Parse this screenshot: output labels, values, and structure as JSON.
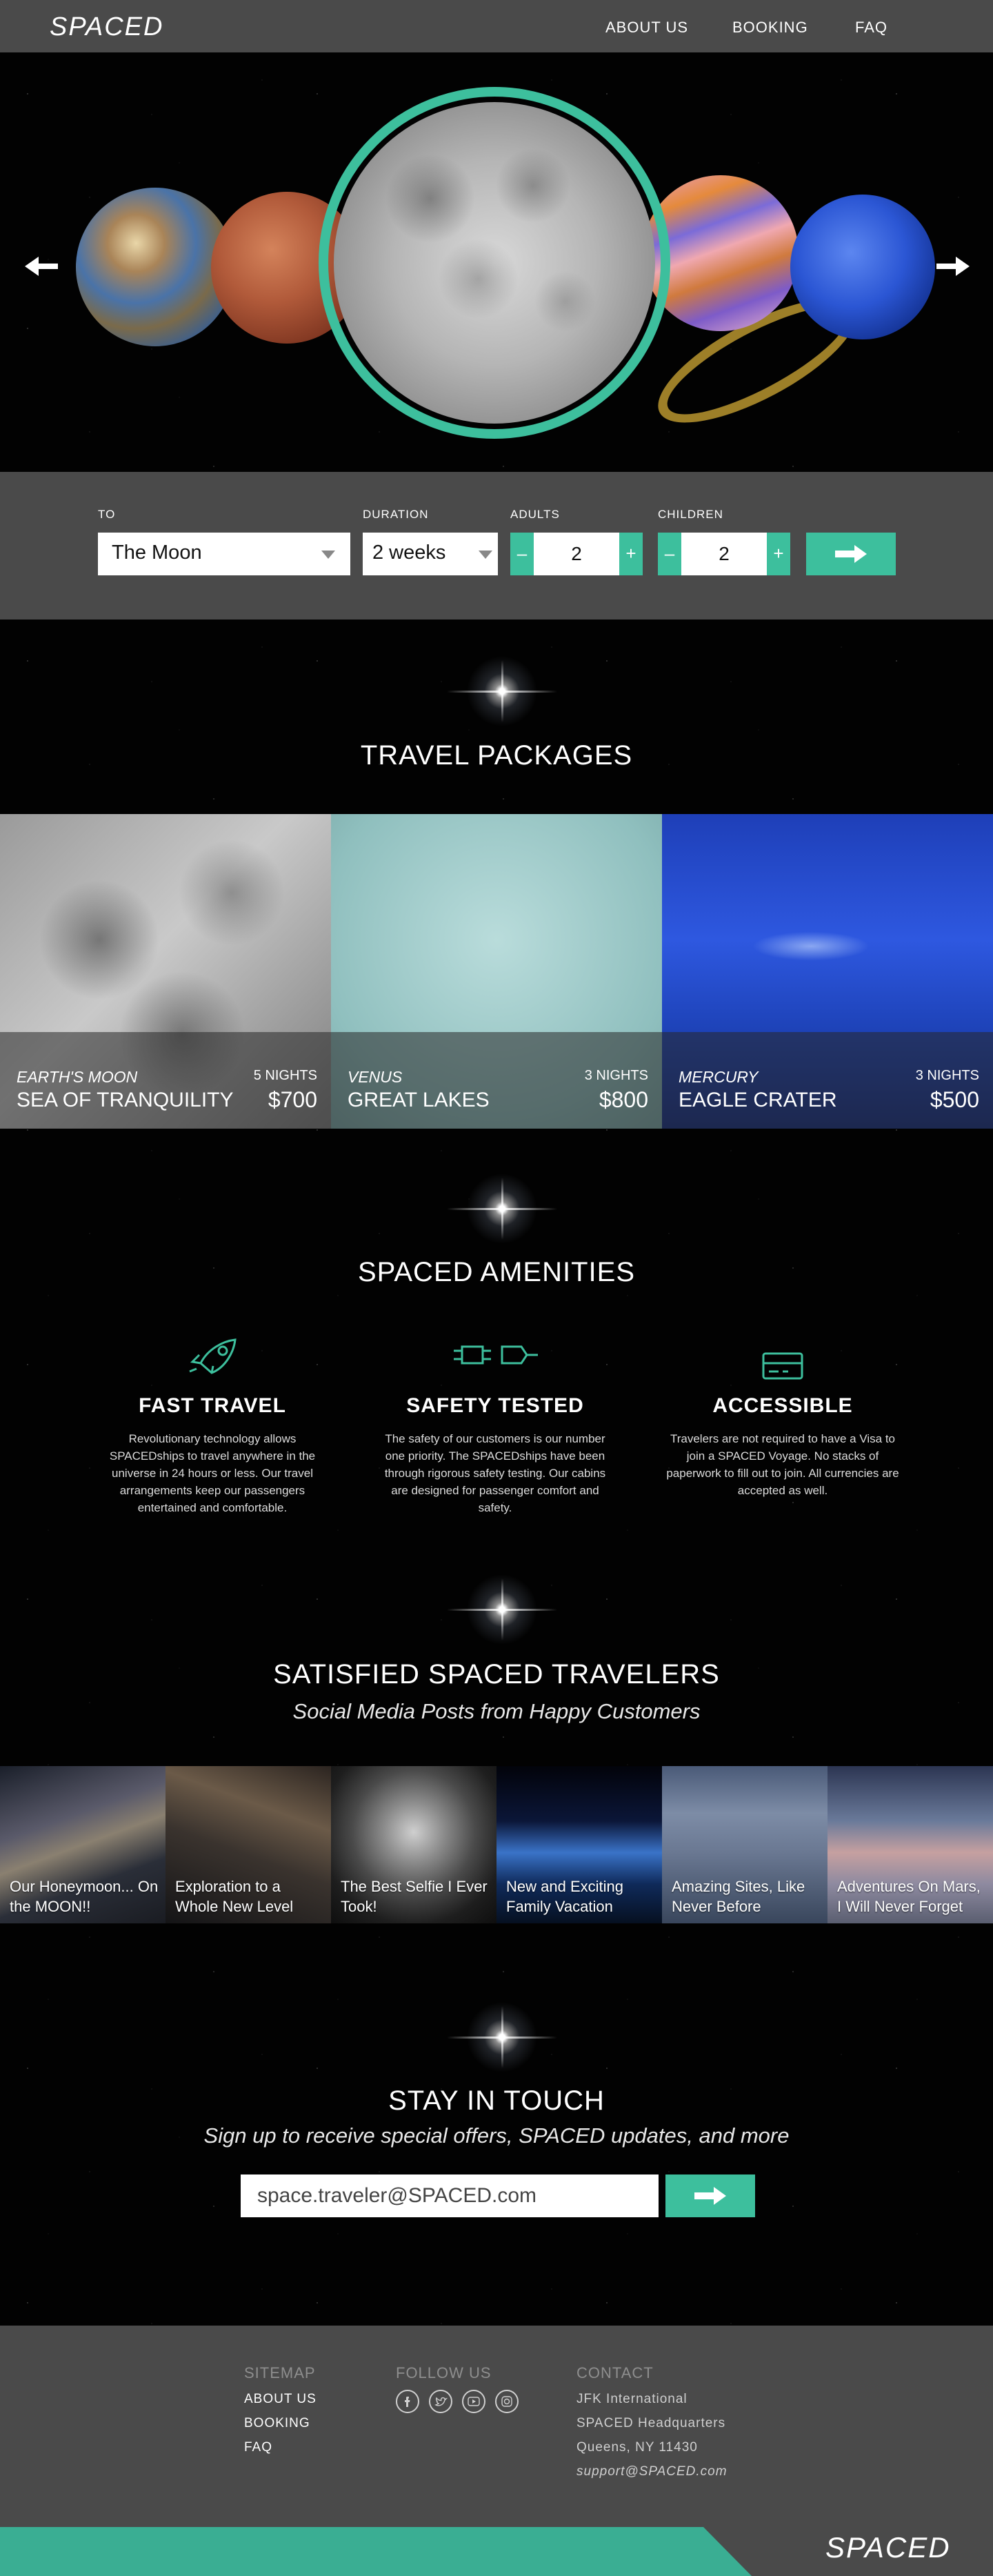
{
  "header": {
    "logo": "SPACED",
    "nav": [
      "ABOUT US",
      "BOOKING",
      "FAQ"
    ]
  },
  "hero": {
    "planets": [
      "mercury-planet",
      "mars-planet",
      "moon-planet",
      "saturn-planet",
      "neptune-planet"
    ],
    "selected": "moon-planet",
    "accent": "#3dbf9d"
  },
  "booking": {
    "to_label": "TO",
    "to_value": "The Moon",
    "duration_label": "DURATION",
    "duration_value": "2 weeks",
    "adults_label": "ADULTS",
    "adults_value": "2",
    "children_label": "CHILDREN",
    "children_value": "2",
    "minus": "–",
    "plus": "+"
  },
  "packages": {
    "title": "TRAVEL PACKAGES",
    "items": [
      {
        "place": "EARTH'S MOON",
        "name": "SEA OF TRANQUILITY",
        "nights": "5 NIGHTS",
        "price": "$700"
      },
      {
        "place": "VENUS",
        "name": "GREAT LAKES",
        "nights": "3 NIGHTS",
        "price": "$800"
      },
      {
        "place": "MERCURY",
        "name": "EAGLE CRATER",
        "nights": "3 NIGHTS",
        "price": "$500"
      }
    ]
  },
  "amenities": {
    "title": "SPACED AMENITIES",
    "items": [
      {
        "icon": "rocket-icon",
        "title": "FAST TRAVEL",
        "text": "Revolutionary technology allows SPACEDships to travel anywhere in the universe in 24 hours or less. Our travel arrangements keep our passengers entertained and comfortable."
      },
      {
        "icon": "plug-icon",
        "title": "SAFETY TESTED",
        "text": "The safety of our customers is our number one priority. The SPACEDships have been through rigorous safety testing. Our cabins are designed for passenger comfort and safety."
      },
      {
        "icon": "credit-card-icon",
        "title": "ACCESSIBLE",
        "text": "Travelers are not required to have a Visa to join a SPACED Voyage. No stacks of paperwork to fill out to join. All currencies are accepted as well."
      }
    ]
  },
  "travelers": {
    "title": "SATISFIED SPACED TRAVELERS",
    "subtitle": "Social Media Posts from Happy Customers",
    "posts": [
      "Our Honeymoon... On the MOON!!",
      "Exploration to a Whole New Level",
      "The Best Selfie I Ever Took!",
      "New and Exciting Family Vacation",
      "Amazing Sites, Like Never Before",
      "Adventures On Mars, I Will Never Forget"
    ]
  },
  "newsletter": {
    "title": "STAY IN TOUCH",
    "subtitle": "Sign up to receive special offers, SPACED updates, and more",
    "email_value": "space.traveler@SPACED.com"
  },
  "footer": {
    "sitemap_head": "SITEMAP",
    "sitemap": [
      "ABOUT US",
      "BOOKING",
      "FAQ"
    ],
    "follow_head": "FOLLOW US",
    "social_icons": [
      "facebook-icon",
      "twitter-icon",
      "youtube-icon",
      "instagram-icon"
    ],
    "contact_head": "CONTACT",
    "contact": [
      "JFK International",
      "SPACED Headquarters",
      "Queens, NY 11430"
    ],
    "email": "support@SPACED.com",
    "logo": "SPACED"
  }
}
